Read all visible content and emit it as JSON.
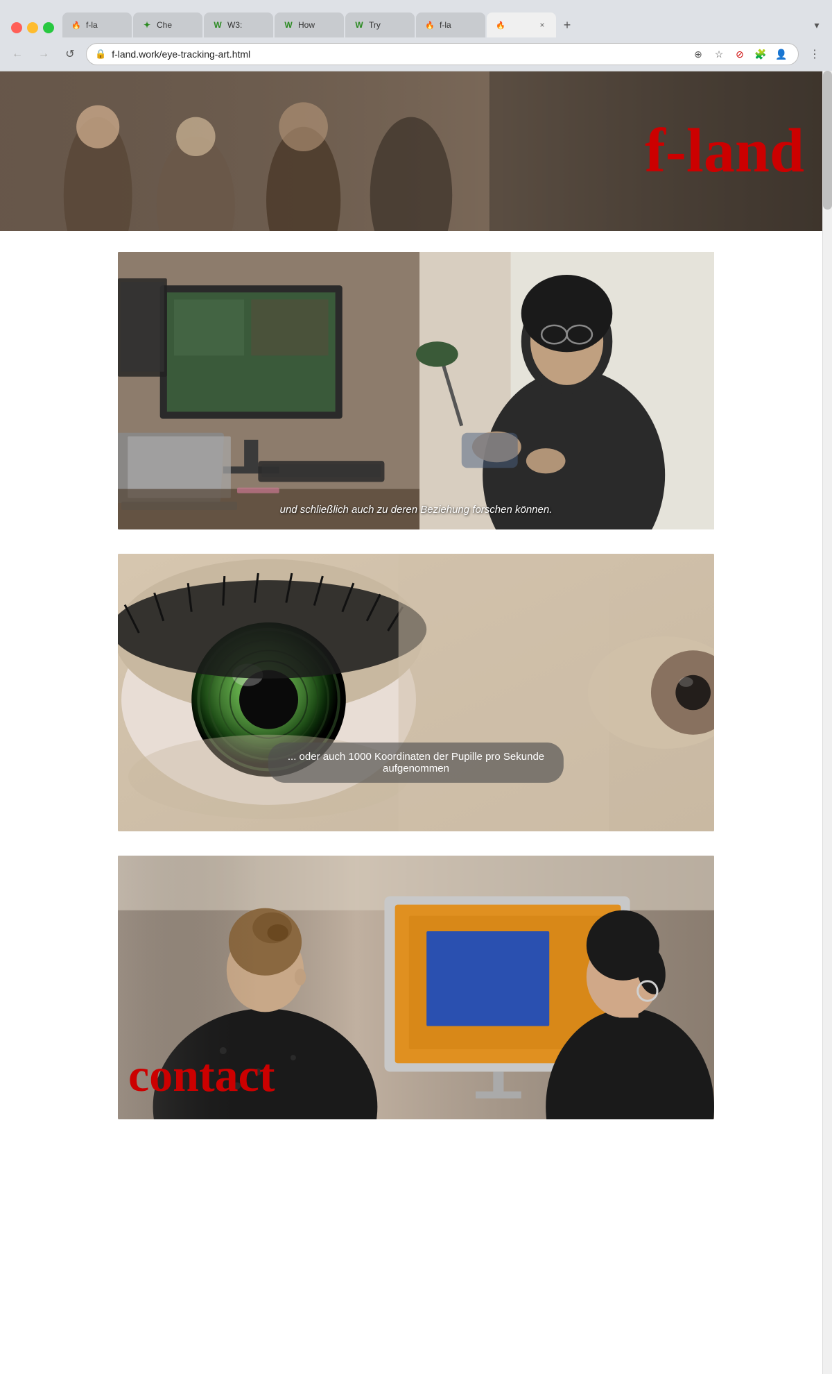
{
  "browser": {
    "tabs": [
      {
        "id": "tab1",
        "favicon": "f-land",
        "label": "f-la",
        "active": false,
        "closeable": false
      },
      {
        "id": "tab2",
        "favicon": "Che",
        "label": "Che",
        "active": false,
        "closeable": false
      },
      {
        "id": "tab3",
        "favicon": "W3",
        "label": "W3:",
        "active": false,
        "closeable": false
      },
      {
        "id": "tab4",
        "favicon": "How",
        "label": "How",
        "active": false,
        "closeable": false
      },
      {
        "id": "tab5",
        "favicon": "Try",
        "label": "Try",
        "active": false,
        "closeable": false
      },
      {
        "id": "tab6",
        "favicon": "f-la",
        "label": "f-la",
        "active": false,
        "closeable": false
      },
      {
        "id": "tab7",
        "favicon": "active",
        "label": "",
        "active": true,
        "closeable": true
      }
    ],
    "url": "f-land.work/eye-tracking-art.html",
    "new_tab_label": "+",
    "overflow_label": "▾"
  },
  "nav": {
    "back_label": "←",
    "forward_label": "→",
    "reload_label": "↺",
    "menu_label": "⋮"
  },
  "hero": {
    "logo_text": "f-land"
  },
  "video1": {
    "caption": "und schließlich auch zu deren Beziehung forschen können."
  },
  "video2": {
    "caption_line1": "... oder auch 1000 Koordinaten der Pupille pro Sekunde",
    "caption_line2": "aufgenommen"
  },
  "contact": {
    "label": "contact"
  },
  "colors": {
    "brand_red": "#cc0000",
    "tab_active_bg": "#f0f0f0",
    "tab_inactive_bg": "#c8cbcf",
    "chrome_bg": "#dee1e6"
  }
}
